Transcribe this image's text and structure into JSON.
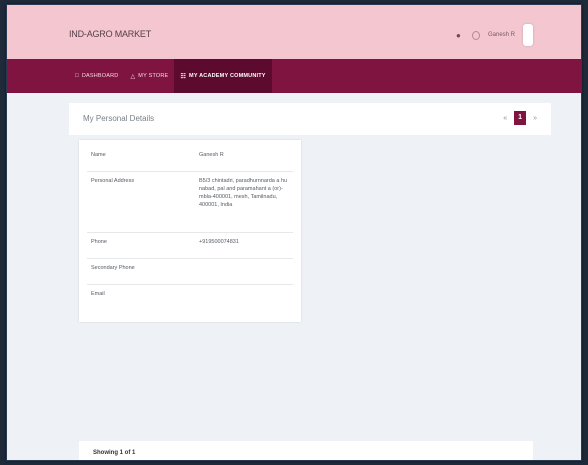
{
  "app": {
    "title": "IND-AGRO MARKET"
  },
  "header": {
    "user_name": "Ganesh R",
    "icons": [
      "bell-icon",
      "user-icon"
    ]
  },
  "nav": {
    "items": [
      {
        "label": "DASHBOARD",
        "icon": "dashboard-icon"
      },
      {
        "label": "MY STORE",
        "icon": "store-icon"
      },
      {
        "label": "MY ACADEMY COMMUNITY",
        "icon": "community-icon"
      }
    ]
  },
  "subheader": {
    "title": "My Personal Details"
  },
  "pager": {
    "prev": "«",
    "current": "1",
    "next": "»"
  },
  "details": {
    "rows": [
      {
        "label": "Name",
        "value": "Ganesh R"
      },
      {
        "label": "Personal Address",
        "value": "B5/3 chintadri, paradhurnnarda a hu nabad, pal and paramahant a (or)-mbla-400001, mesh, Tamilnadu, 400001, India"
      },
      {
        "label": "Phone",
        "value": "+919500074831"
      },
      {
        "label": "Secondary Phone",
        "value": ""
      },
      {
        "label": "Email",
        "value": ""
      }
    ]
  },
  "footer": {
    "showing": "Showing 1 of 1"
  },
  "colors": {
    "topbar": "#f3c6d0",
    "navbar": "#7f1440",
    "accent": "#7f1440",
    "background": "#eef1f5"
  }
}
